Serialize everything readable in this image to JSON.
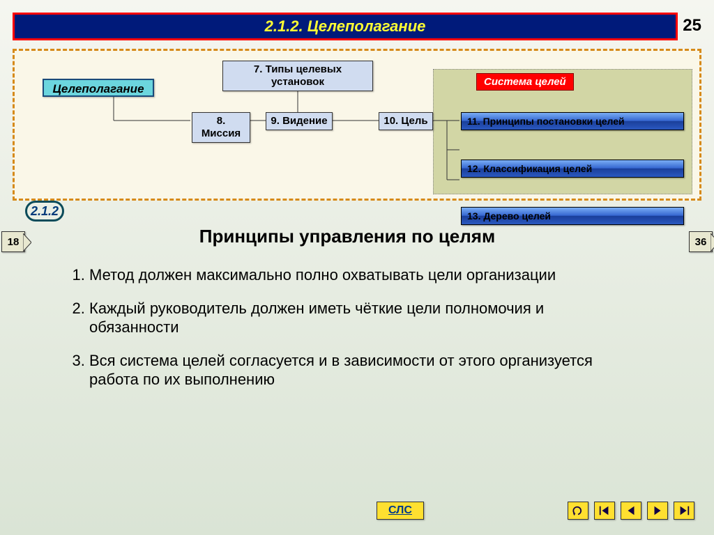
{
  "header": {
    "title": "2.1.2. Целеполагание",
    "page_number": "25"
  },
  "diagram": {
    "main_node": "Целеполагание",
    "node7": "7. Типы целевых установок",
    "node8": "8. Миссия",
    "node9": "9. Видение",
    "node10": "10. Цель",
    "system_title": "Система целей",
    "node11": "11. Принципы постановки целей",
    "node12": "12. Классификация целей",
    "node13": "13. Дерево целей",
    "section_badge": "2.1.2"
  },
  "nav": {
    "prev": "18",
    "next": "36",
    "sls": "СЛС"
  },
  "content": {
    "title": "Принципы управления по целям",
    "items": [
      "Метод должен максимально полно охватывать цели организации",
      "Каждый руководитель должен иметь чёткие цели полномочия и обязанности",
      "Вся система целей согласуется и в зависимости от этого организуется работа по их выполнению"
    ]
  },
  "colors": {
    "accent_yellow": "#ffe030",
    "header_bg": "#001a7a",
    "header_border": "#ff0000"
  }
}
